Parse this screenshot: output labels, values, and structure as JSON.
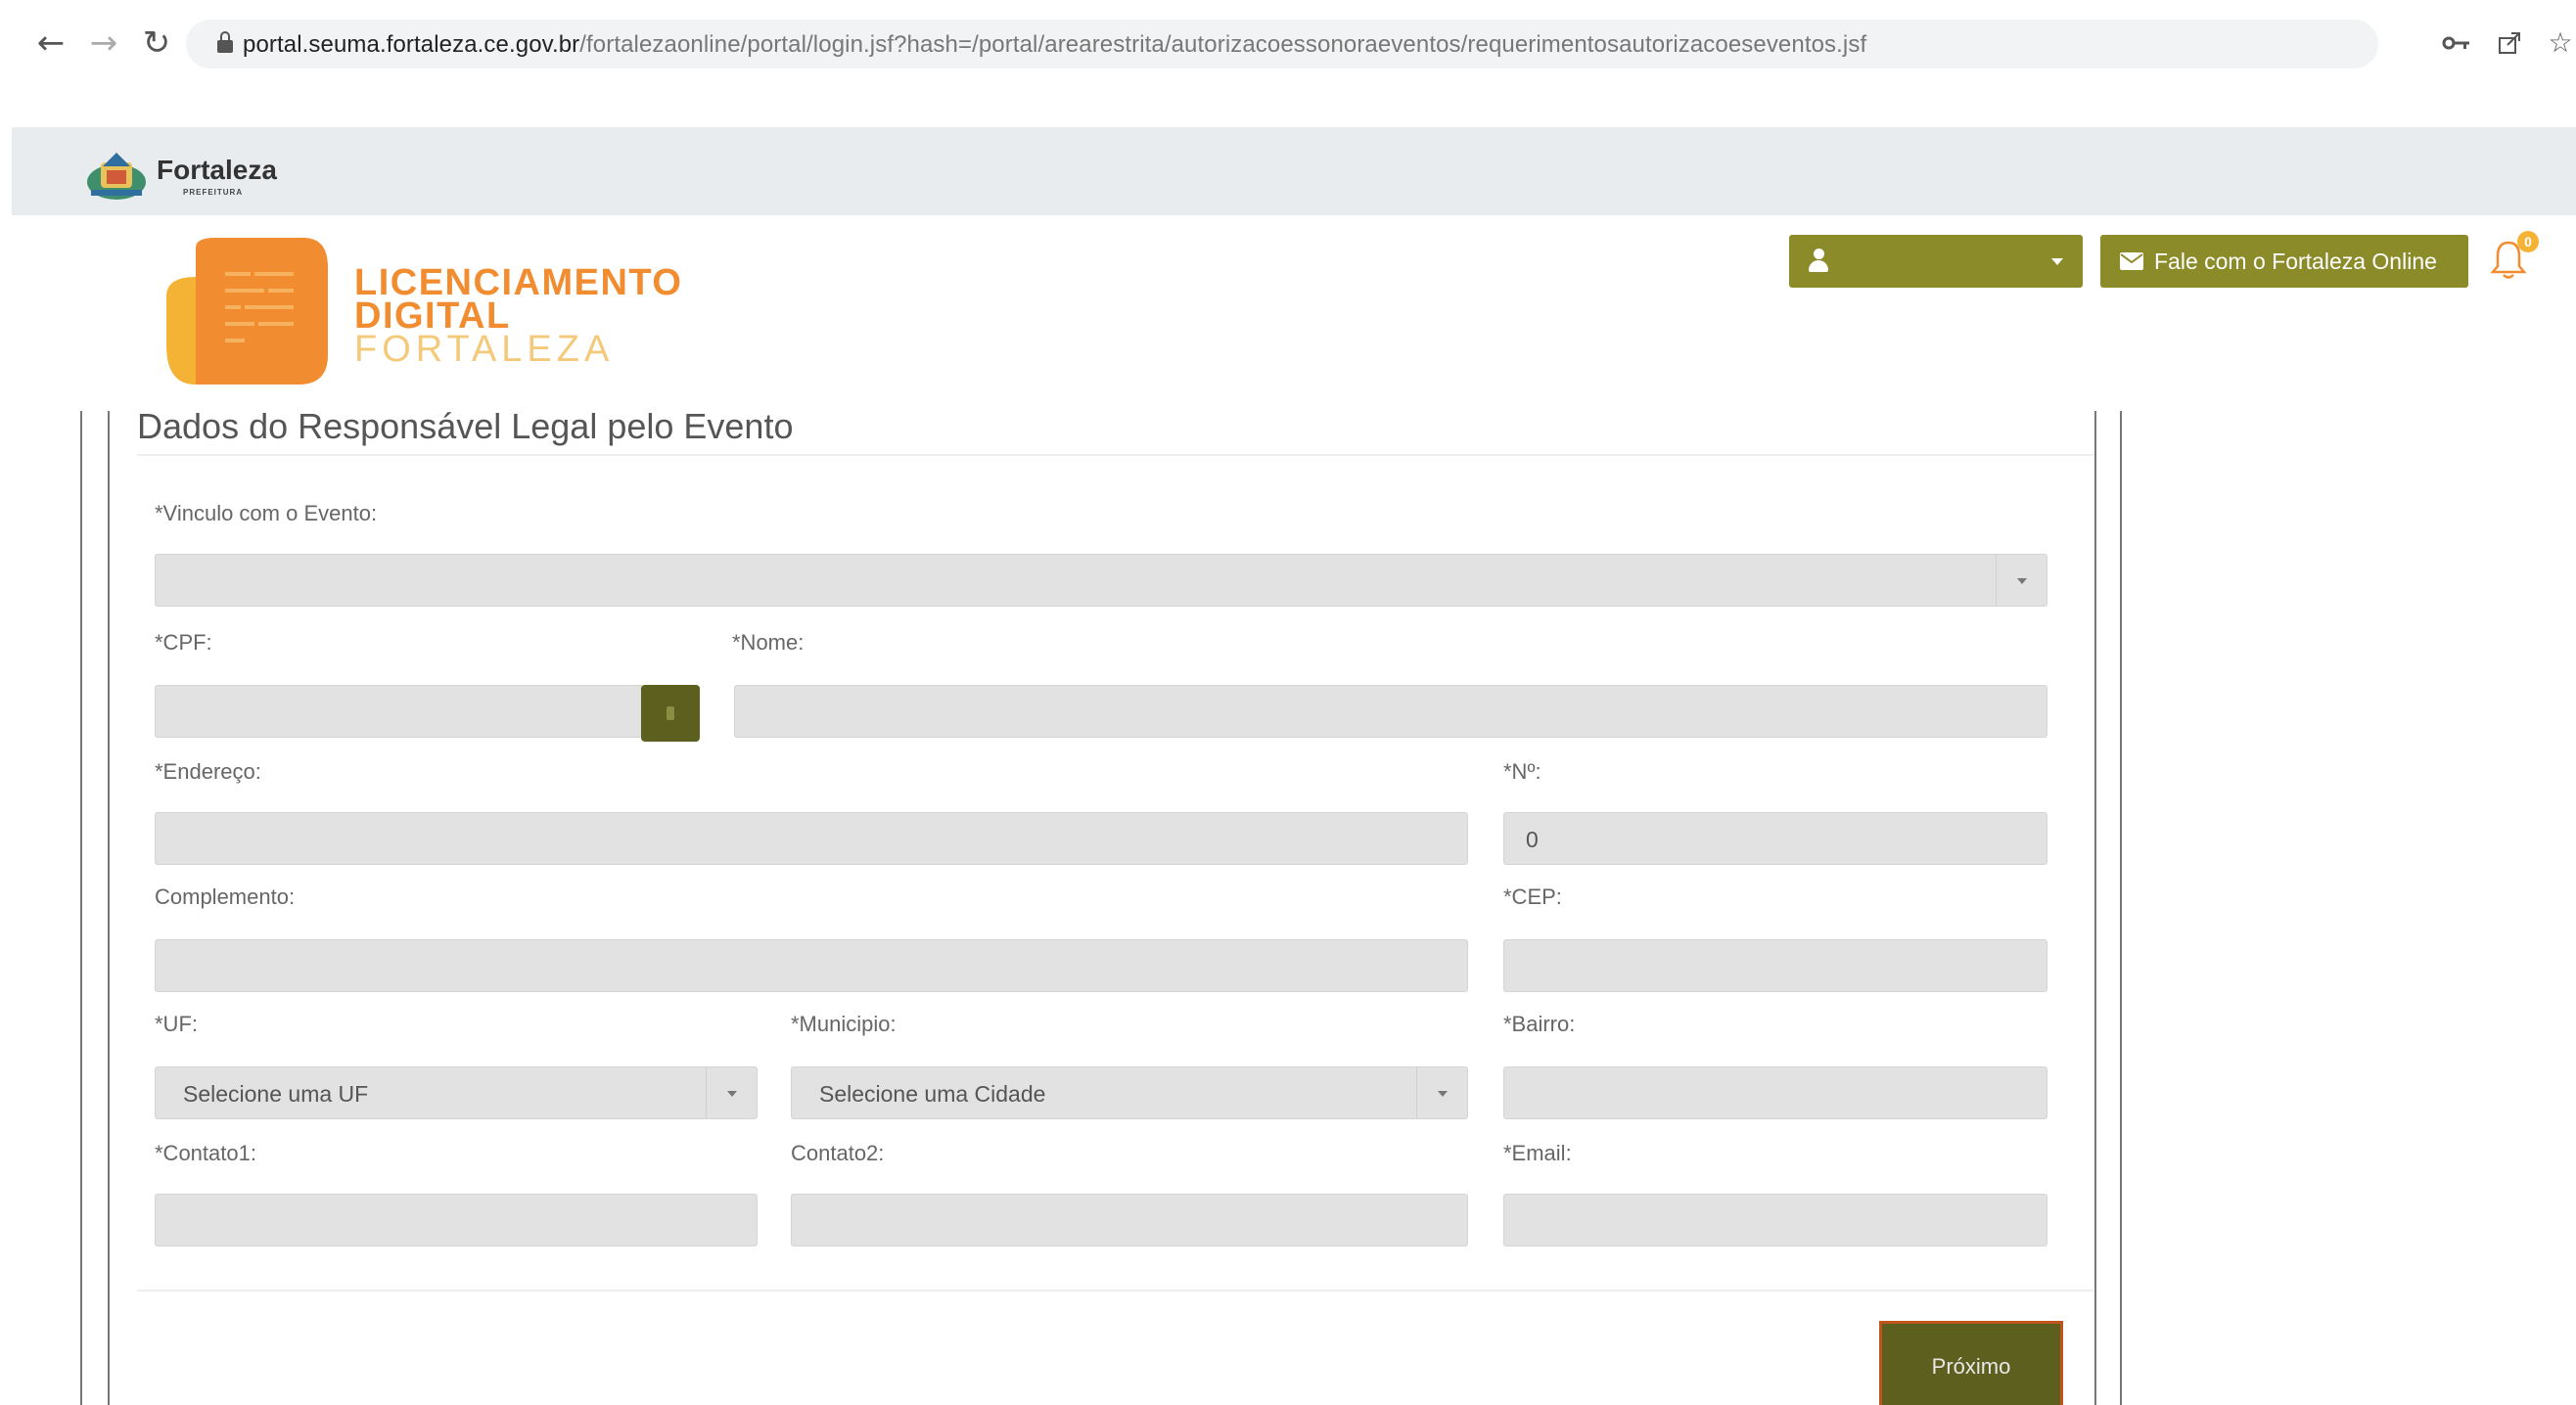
{
  "browser": {
    "url_host": "portal.seuma.fortaleza.ce.gov.br",
    "url_path": "/fortalezaonline/portal/login.jsf?hash=/portal/arearestrita/autorizacoessonoraeventos/requerimentosautorizacoeseventos.jsf",
    "icons": {
      "back": "←",
      "forward": "→",
      "reload": "↻",
      "key": "key-icon",
      "share": "share-icon",
      "bookmark": "☆"
    }
  },
  "header": {
    "brand": "Fortaleza",
    "brand_sub": "PREFEITURA"
  },
  "lic_logo": {
    "line1": "LICENCIAMENTO",
    "line2": "DIGITAL",
    "line3": "FORTALEZA"
  },
  "actions": {
    "user_menu_label": "",
    "contact_label": "Fale com o Fortaleza Online",
    "notification_count": "0"
  },
  "form": {
    "section_title": "Dados do Responsável Legal pelo Evento",
    "vinculo_label": "*Vinculo com o Evento:",
    "vinculo_value": "",
    "cpf_label": "*CPF:",
    "cpf_value": "",
    "nome_label": "*Nome:",
    "nome_value": "",
    "endereco_label": "*Endereço:",
    "endereco_value": "",
    "numero_label": "*Nº:",
    "numero_value": "0",
    "complemento_label": "Complemento:",
    "complemento_value": "",
    "cep_label": "*CEP:",
    "cep_value": "",
    "uf_label": "*UF:",
    "uf_value": "Selecione uma UF",
    "municipio_label": "*Municipio:",
    "municipio_value": "Selecione uma Cidade",
    "bairro_label": "*Bairro:",
    "bairro_value": "",
    "contato1_label": "*Contato1:",
    "contato1_value": "",
    "contato2_label": "Contato2:",
    "contato2_value": "",
    "email_label": "*Email:",
    "email_value": "",
    "next_label": "Próximo"
  },
  "colors": {
    "accent_olive": "#8c8b2a",
    "button_dark_olive": "#5d5f1e",
    "logo_orange": "#f28c30"
  }
}
